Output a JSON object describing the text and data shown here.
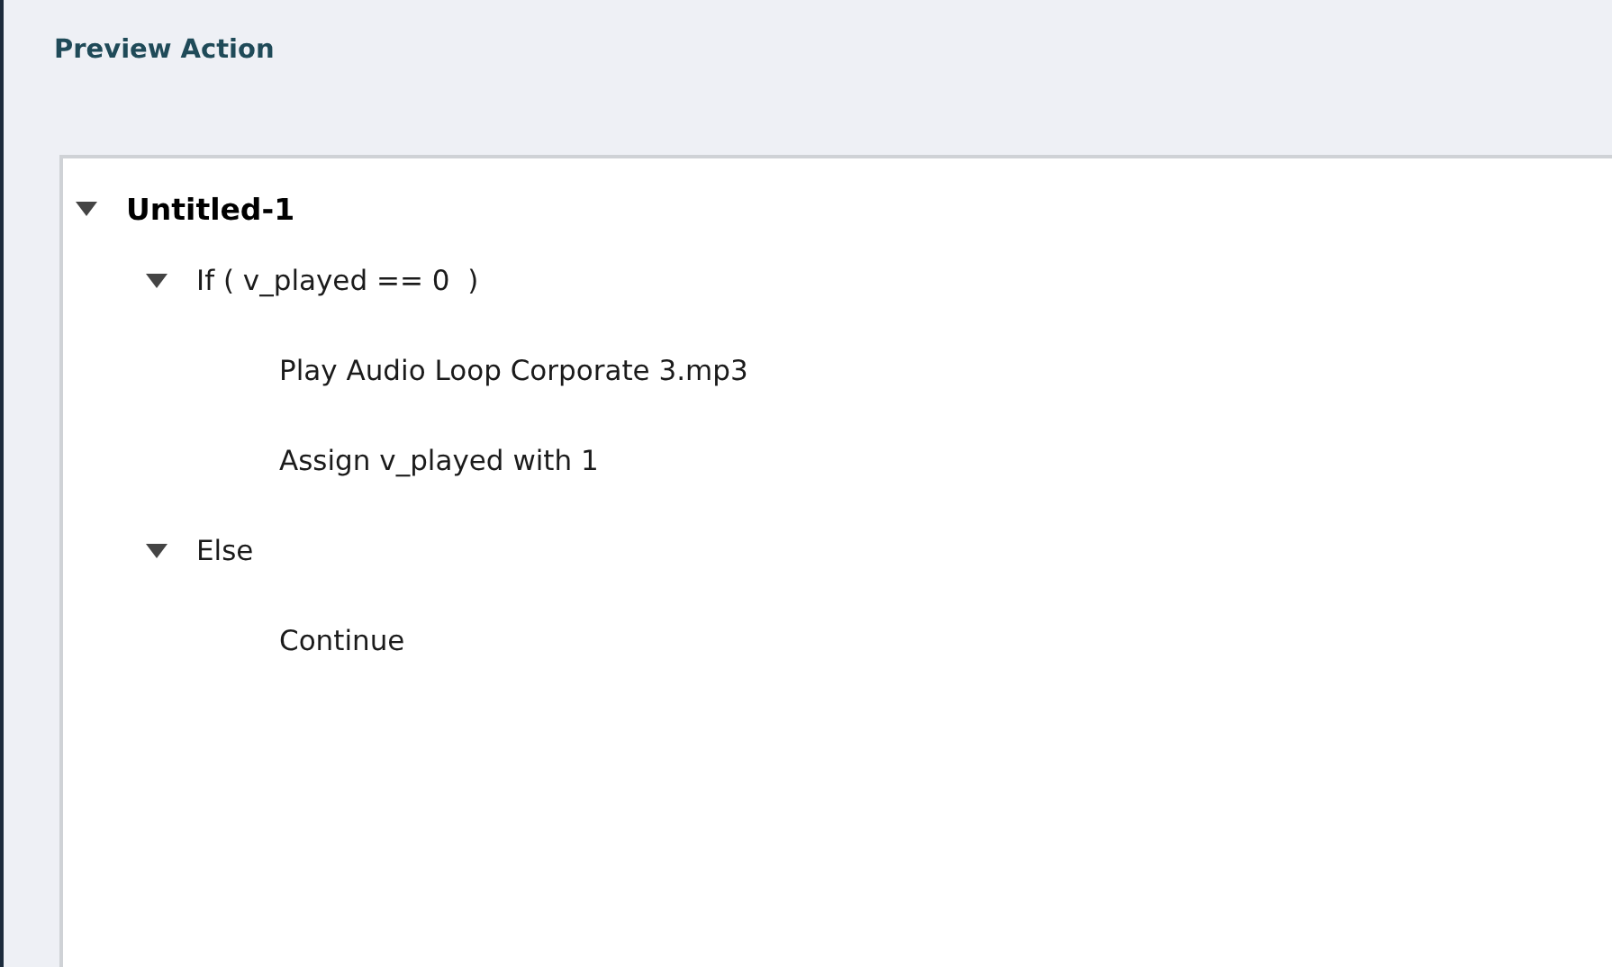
{
  "title": "Preview Action",
  "tree": [
    {
      "label": "Untitled-1",
      "expanded": true,
      "children": [
        {
          "label": "If ( v_played == 0  )",
          "expanded": true,
          "children": [
            {
              "label": "Play Audio Loop Corporate 3.mp3"
            },
            {
              "label": "Assign v_played with 1"
            }
          ]
        },
        {
          "label": "Else",
          "expanded": true,
          "children": [
            {
              "label": "Continue"
            }
          ]
        }
      ]
    }
  ]
}
